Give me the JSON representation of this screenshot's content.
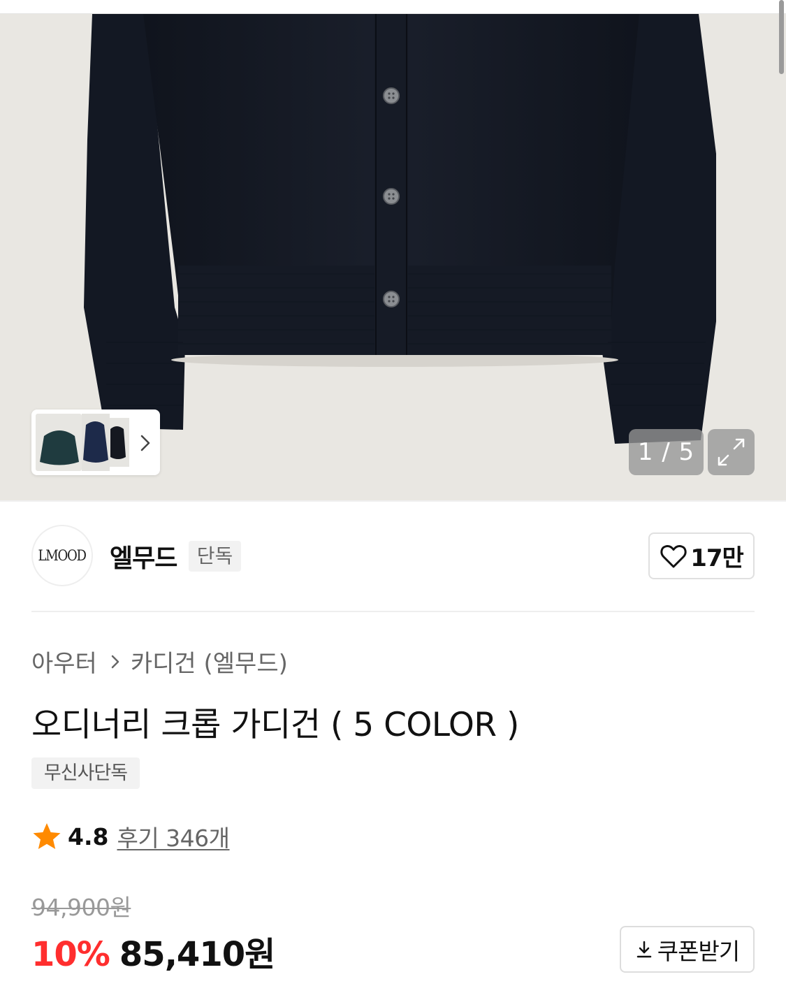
{
  "gallery": {
    "counter": "1 / 5",
    "current_index": 1,
    "total_images": 5,
    "expand_icon": "expand-arrows-icon",
    "thumbnail_next_icon": "chevron-right-icon",
    "background_color": "#e9e7e2",
    "product_color": "#151a24"
  },
  "brand": {
    "logo_text": "LMOOD",
    "name": "엘무드",
    "badge": "단독",
    "like_icon": "heart-outline-icon",
    "like_count": "17만"
  },
  "breadcrumb": {
    "items": [
      "아우터",
      "카디건 (엘무드)"
    ],
    "separator_icon": "chevron-right-icon"
  },
  "product": {
    "title": "오디너리 크롭 가디건 ( 5 COLOR )",
    "tag": "무신사단독",
    "rating_icon": "star-icon",
    "rating_color": "#ff8a00",
    "rating": "4.8",
    "review_link": "후기 346개"
  },
  "price": {
    "original": "94,900원",
    "discount_rate": "10%",
    "sale": "85,410원",
    "discount_color": "#ff2e2e"
  },
  "coupon": {
    "icon": "download-icon",
    "label": "쿠폰받기"
  }
}
